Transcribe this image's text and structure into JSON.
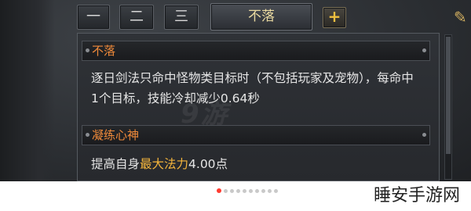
{
  "tabs": {
    "t1": "一",
    "t2": "二",
    "t3": "三",
    "main": "不落",
    "plus": "+"
  },
  "sections": [
    {
      "title": "不落",
      "text": "逐日剑法只命中怪物类目标时（不包括玩家及宠物），每命中1个目标，技能冷却减少0.64秒"
    },
    {
      "title": "凝练心神",
      "text_prefix": "提高自身",
      "text_highlight": "最大法力",
      "text_suffix": "4.00点"
    }
  ],
  "watermark": "9游",
  "pager": {
    "total": 10,
    "active_index": 0
  },
  "site_logo": "睡安手游网",
  "colors": {
    "section_title": "#f08a3a",
    "highlight": "#f3b43c",
    "pager_active": "#ff3b30"
  }
}
